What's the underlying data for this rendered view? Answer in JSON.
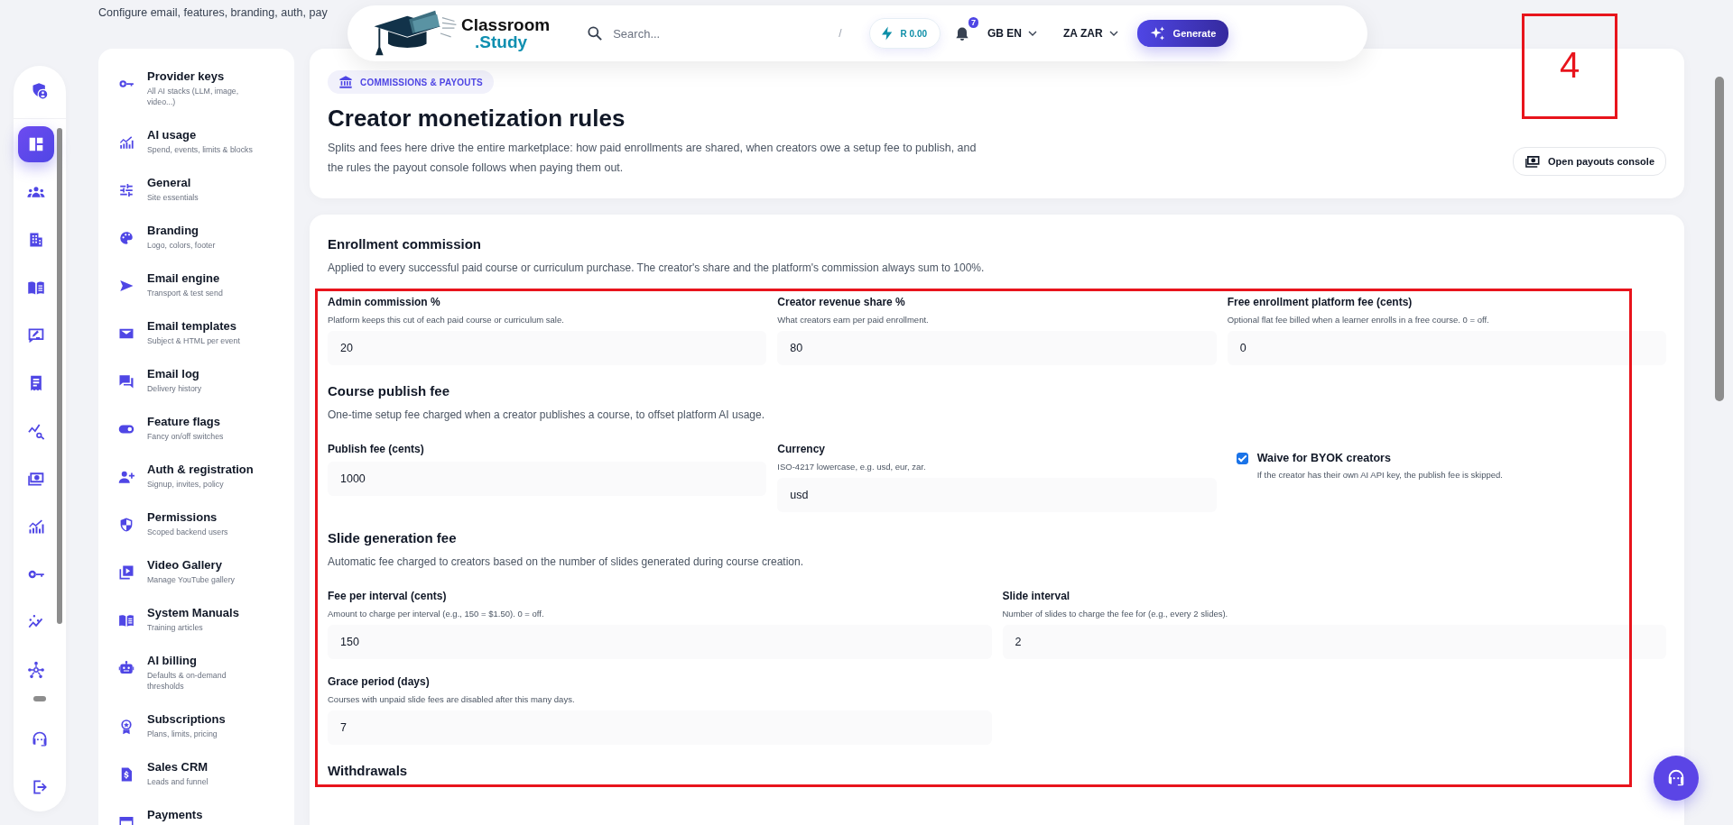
{
  "page_subtitle": "Configure email, features, branding, auth, pay",
  "topbar": {
    "logo_line1": "Classroom",
    "logo_line2": ".Study",
    "search_placeholder": "Search...",
    "search_shortcut": "/",
    "balance": "R 0.00",
    "notifications": "7",
    "language": "GB EN",
    "currency": "ZA ZAR",
    "generate": "Generate"
  },
  "rail": {
    "top": [
      {
        "kind": "shield-user",
        "selected": false
      }
    ],
    "scroll": [
      {
        "kind": "dashboard",
        "selected": true
      },
      {
        "kind": "group",
        "selected": false
      },
      {
        "kind": "building",
        "selected": false
      },
      {
        "kind": "book",
        "selected": false
      },
      {
        "kind": "presentation",
        "selected": false
      },
      {
        "kind": "receipt",
        "selected": false
      },
      {
        "kind": "chart-search",
        "selected": false
      },
      {
        "kind": "cash",
        "selected": false
      },
      {
        "kind": "chart",
        "selected": false
      },
      {
        "kind": "key",
        "selected": false
      },
      {
        "kind": "trend",
        "selected": false
      },
      {
        "kind": "network",
        "selected": false
      }
    ],
    "bottom": [
      {
        "kind": "headset",
        "selected": false
      },
      {
        "kind": "logout",
        "selected": false
      }
    ]
  },
  "nav": [
    {
      "kind": "key",
      "title": "Provider keys",
      "subtitle": "All AI stacks (LLM, image, video...)"
    },
    {
      "kind": "chart",
      "title": "AI usage",
      "subtitle": "Spend, events, limits & blocks"
    },
    {
      "kind": "sliders",
      "title": "General",
      "subtitle": "Site essentials"
    },
    {
      "kind": "palette",
      "title": "Branding",
      "subtitle": "Logo, colors, footer"
    },
    {
      "kind": "send",
      "title": "Email engine",
      "subtitle": "Transport & test send"
    },
    {
      "kind": "mail",
      "title": "Email templates",
      "subtitle": "Subject & HTML per event"
    },
    {
      "kind": "chat",
      "title": "Email log",
      "subtitle": "Delivery history"
    },
    {
      "kind": "toggle",
      "title": "Feature flags",
      "subtitle": "Fancy on/off switches"
    },
    {
      "kind": "add-user",
      "title": "Auth & registration",
      "subtitle": "Signup, invites, policy"
    },
    {
      "kind": "shield",
      "title": "Permissions",
      "subtitle": "Scoped backend users"
    },
    {
      "kind": "video",
      "title": "Video Gallery",
      "subtitle": "Manage YouTube gallery"
    },
    {
      "kind": "book",
      "title": "System Manuals",
      "subtitle": "Training articles"
    },
    {
      "kind": "robot",
      "title": "AI billing",
      "subtitle": "Defaults & on-demand thresholds"
    },
    {
      "kind": "award",
      "title": "Subscriptions",
      "subtitle": "Plans, limits, pricing"
    },
    {
      "kind": "invoice",
      "title": "Sales CRM",
      "subtitle": "Leads and funnel"
    },
    {
      "kind": "card",
      "title": "Payments"
    }
  ],
  "header": {
    "badge": "COMMISSIONS & PAYOUTS",
    "title": "Creator monetization rules",
    "description": "Splits and fees here drive the entire marketplace: how paid enrollments are shared, when creators owe a setup fee to publish, and the rules the payout console follows when paying them out.",
    "action": "Open payouts console"
  },
  "sections": [
    {
      "title": "Enrollment commission",
      "description": "Applied to every successful paid course or curriculum purchase. The creator's share and the platform's commission always sum to 100%.",
      "rows": [
        [
          {
            "kind": "input",
            "label": "Admin commission %",
            "hint": "Platform keeps this cut of each paid course or curriculum sale.",
            "value": "20"
          },
          {
            "kind": "input",
            "label": "Creator revenue share %",
            "hint": "What creators earn per paid enrollment.",
            "value": "80"
          },
          {
            "kind": "input",
            "label": "Free enrollment platform fee (cents)",
            "hint": "Optional flat fee billed when a learner enrolls in a free course. 0 = off.",
            "value": "0"
          }
        ]
      ]
    },
    {
      "title": "Course publish fee",
      "description": "One-time setup fee charged when a creator publishes a course, to offset platform AI usage.",
      "rows": [
        [
          {
            "kind": "input",
            "label": "Publish fee (cents)",
            "value": "1000"
          },
          {
            "kind": "input",
            "label": "Currency",
            "hint": "ISO-4217 lowercase, e.g. usd, eur, zar.",
            "value": "usd"
          },
          {
            "kind": "checkbox",
            "label": "Waive for BYOK creators",
            "hint": "If the creator has their own AI API key, the publish fee is skipped.",
            "checked": true
          }
        ]
      ]
    },
    {
      "title": "Slide generation fee",
      "description": "Automatic fee charged to creators based on the number of slides generated during course creation.",
      "rows": [
        [
          {
            "kind": "input",
            "label": "Fee per interval (cents)",
            "hint": "Amount to charge per interval (e.g., 150 = $1.50). 0 = off.",
            "value": "150"
          },
          {
            "kind": "input",
            "label": "Slide interval",
            "hint": "Number of slides to charge the fee for (e.g., every 2 slides).",
            "value": "2"
          }
        ],
        [
          {
            "kind": "input",
            "label": "Grace period (days)",
            "hint": "Courses with unpaid slide fees are disabled after this many days.",
            "value": "7"
          }
        ]
      ]
    },
    {
      "title": "Withdrawals"
    }
  ],
  "annotation": {
    "label": "4"
  }
}
